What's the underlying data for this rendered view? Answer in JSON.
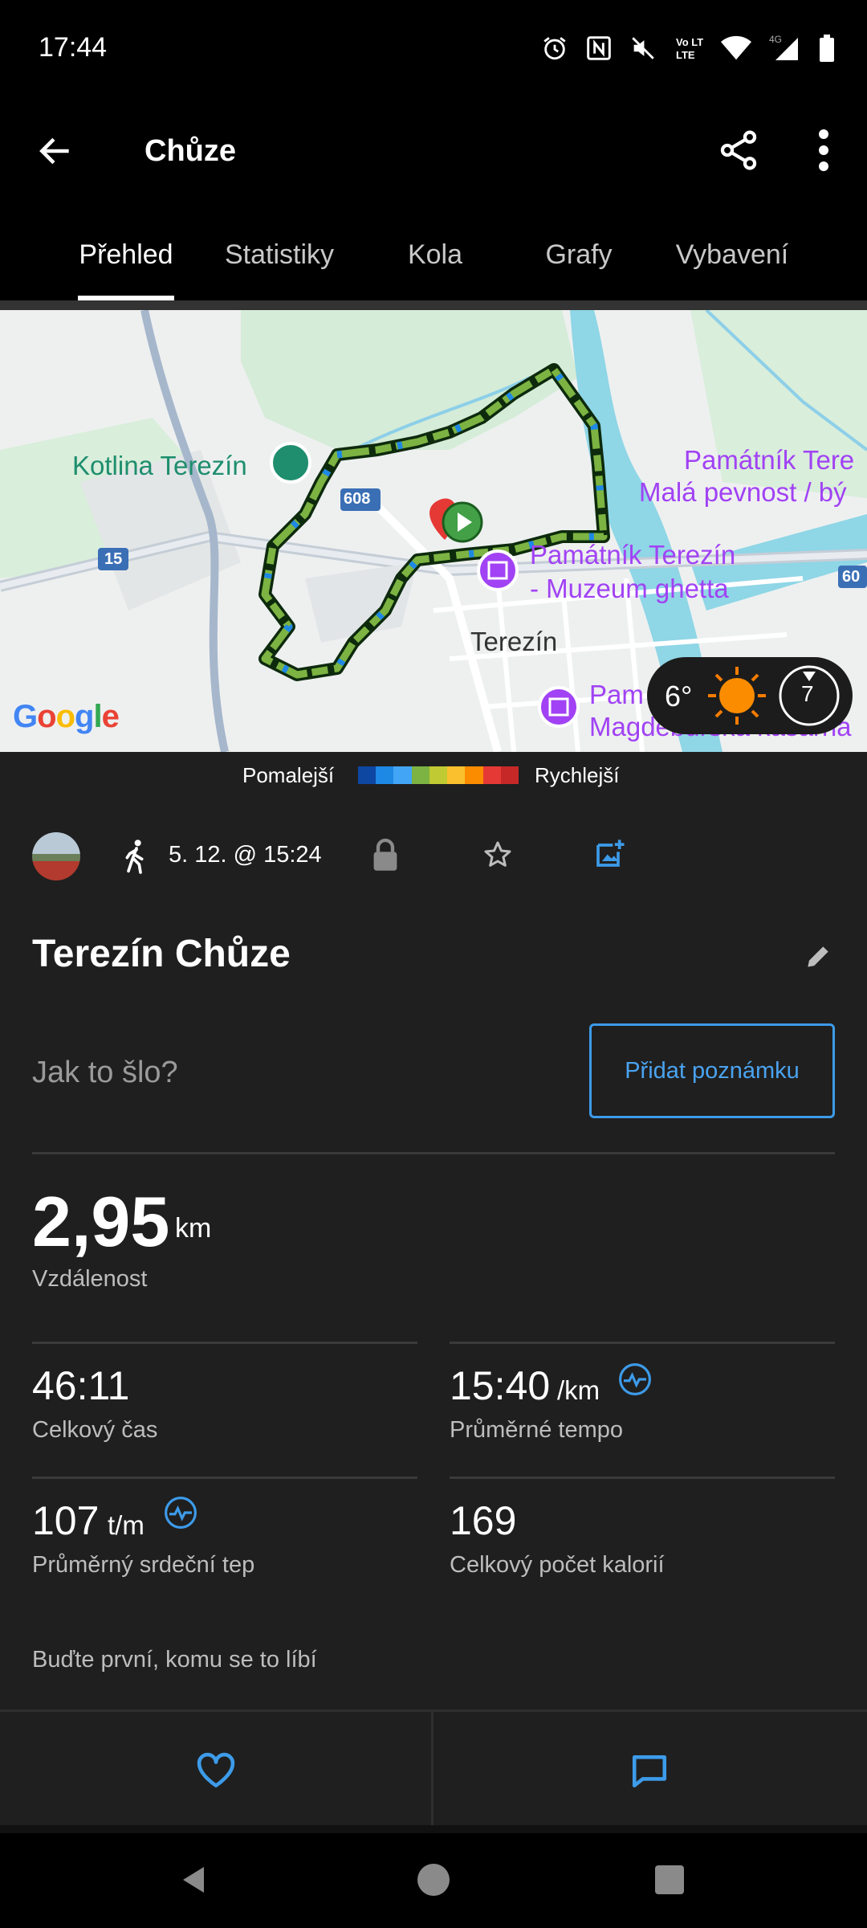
{
  "status_bar": {
    "time": "17:44",
    "network": "4G",
    "volte": "Vo LTE",
    "icons": [
      "alarm-icon",
      "nfc-icon",
      "mute-icon",
      "volte-icon",
      "wifi-icon",
      "signal-icon",
      "battery-icon"
    ]
  },
  "app_bar": {
    "title": "Chůze",
    "icons": [
      "back-arrow-icon",
      "share-icon",
      "more-vert-icon"
    ]
  },
  "tabs": [
    {
      "label": "Přehled",
      "active": true
    },
    {
      "label": "Statistiky",
      "active": false
    },
    {
      "label": "Kola",
      "active": false
    },
    {
      "label": "Grafy",
      "active": false
    },
    {
      "label": "Vybavení",
      "active": false
    }
  ],
  "map": {
    "labels": {
      "kotlina": "Kotlina Terezín",
      "route_608": "608",
      "route_15": "15",
      "route_60": "60",
      "pamatnik_mala_line1": "Památník Tere",
      "pamatnik_mala_line2": "Malá pevnost / bý",
      "muzeum_line1": "Památník Terezín",
      "muzeum_line2": "- Muzeum ghetta",
      "town": "Terezín",
      "magdeburska_line1": "Pam",
      "magdeburska_line2": "Magdeburská kasárna",
      "google": "Google"
    },
    "weather": {
      "temperature": "6°",
      "wind": "7",
      "icon": "sun-icon"
    }
  },
  "legend": {
    "slower": "Pomalejší",
    "faster": "Rychlejší",
    "colors": [
      "#0d47a1",
      "#1e88e5",
      "#42a5f5",
      "#7cb342",
      "#c0ca33",
      "#fbc02d",
      "#fb8c00",
      "#e53935",
      "#c62828"
    ]
  },
  "activity": {
    "activity_icon": "walk-icon",
    "date": "5. 12. @ 15:24",
    "title": "Terezín Chůze",
    "note_prompt": "Jak to šlo?",
    "note_button": "Přidat poznámku"
  },
  "stats": {
    "distance": {
      "value": "2,95",
      "unit": "km",
      "label": "Vzdálenost"
    },
    "total_time": {
      "value": "46:11",
      "label": "Celkový čas"
    },
    "avg_pace": {
      "value": "15:40",
      "unit": "/km",
      "label": "Průměrné tempo"
    },
    "avg_hr": {
      "value": "107",
      "unit": "t/m",
      "label": "Průměrný srdeční tep"
    },
    "calories": {
      "value": "169",
      "label": "Celkový počet kalorií"
    }
  },
  "social": {
    "like_text": "Buďte první, komu se to líbí",
    "like_icon": "heart-icon",
    "comment_icon": "comment-icon"
  },
  "accent_color": "#3d9be9"
}
